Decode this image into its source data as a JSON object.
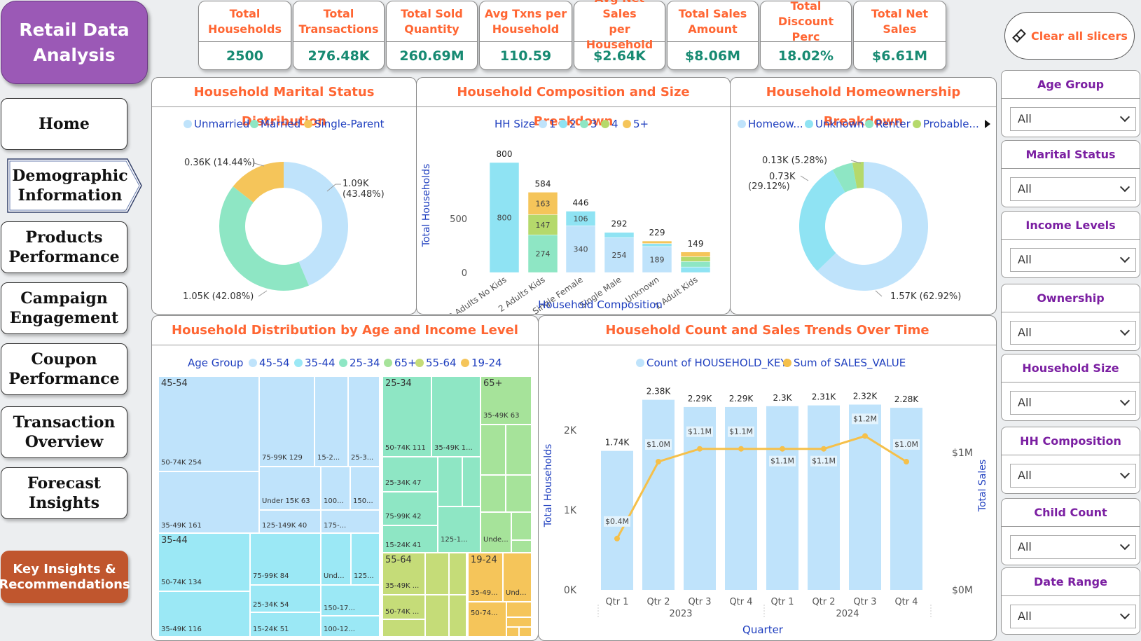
{
  "title": {
    "line1": "Retail Data",
    "line2": "Analysis"
  },
  "nav": {
    "home": "Home",
    "demographic": [
      "Demographic",
      "Information"
    ],
    "products": [
      "Products",
      "Performance"
    ],
    "campaign": [
      "Campaign",
      "Engagement"
    ],
    "coupon": [
      "Coupon",
      "Performance"
    ],
    "transaction": [
      "Transaction",
      "Overview"
    ],
    "forecast": [
      "Forecast",
      "Insights"
    ],
    "key": [
      "Key Insights &",
      "Recommendations"
    ]
  },
  "kpis": [
    {
      "label1": "Total",
      "label2": "Households",
      "value": "2500"
    },
    {
      "label1": "Total",
      "label2": "Transactions",
      "value": "276.48K"
    },
    {
      "label1": "Total Sold",
      "label2": "Quantity",
      "value": "260.69M"
    },
    {
      "label1": "Avg Txns per",
      "label2": "Household",
      "value": "110.59"
    },
    {
      "label1": "Avg Net Sales",
      "label2": "per Household",
      "value": "$2.64K"
    },
    {
      "label1": "Total Sales",
      "label2": "Amount",
      "value": "$8.06M"
    },
    {
      "label1": "Total Discount",
      "label2": "Perc",
      "value": "18.02%"
    },
    {
      "label1": "Total Net",
      "label2": "Sales",
      "value": "$6.61M"
    }
  ],
  "clear_slicers": "Clear all slicers",
  "slicers": [
    {
      "title": "Age Group",
      "value": "All"
    },
    {
      "title": "Marital Status",
      "value": "All"
    },
    {
      "title": "Income Levels",
      "value": "All"
    },
    {
      "title": "Ownership",
      "value": "All"
    },
    {
      "title": "Household Size",
      "value": "All"
    },
    {
      "title": "HH Composition",
      "value": "All"
    },
    {
      "title": "Child Count",
      "value": "All"
    },
    {
      "title": "Date Range",
      "value": "All"
    }
  ],
  "colors": {
    "accent": "#ff6633",
    "purple": "#9b59b6",
    "teal": "#178a72",
    "slicer_title": "#7b1fa2",
    "axis_blue": "#1f3fbf"
  },
  "chart_data": [
    {
      "type": "pie",
      "title": "Household Marital Status Distribution",
      "categories": [
        "Unmarried",
        "Married",
        "Single-Parent"
      ],
      "values": [
        1.09,
        1.05,
        0.36
      ],
      "percents": [
        43.48,
        42.08,
        14.44
      ],
      "labels": [
        "1.09K (43.48%)",
        "1.05K (42.08%)",
        "0.36K (14.44%)"
      ],
      "colors": [
        "#bfe3fb",
        "#8ee6c4",
        "#f5c55a"
      ],
      "legend": "top"
    },
    {
      "type": "bar",
      "title": "Household Composition and Size Breakdown",
      "legend_title": "HH Size",
      "xlabel": "Household Composition",
      "ylabel": "Total Households",
      "ylim": [
        0,
        800
      ],
      "yticks": [
        "0",
        "500"
      ],
      "categories": [
        "2 Adults No Kids",
        "2 Adults Kids",
        "Single Female",
        "Single Male",
        "Unknown",
        "1 Adult Kids"
      ],
      "totals": [
        800,
        584,
        446,
        292,
        229,
        149
      ],
      "series": [
        {
          "name": "1",
          "color": "#bfe3fb",
          "values": [
            0,
            0,
            340,
            254,
            189,
            0
          ]
        },
        {
          "name": "2",
          "color": "#8fe3f3",
          "values": [
            800,
            0,
            106,
            38,
            22,
            40
          ]
        },
        {
          "name": "3",
          "color": "#8ee6c4",
          "values": [
            0,
            274,
            0,
            0,
            0,
            40
          ]
        },
        {
          "name": "4",
          "color": "#b5d96b",
          "values": [
            0,
            147,
            0,
            0,
            0,
            35
          ]
        },
        {
          "name": "5+",
          "color": "#f5c55a",
          "values": [
            0,
            163,
            0,
            0,
            18,
            34
          ]
        }
      ],
      "data_labels": [
        "800",
        "163",
        "147",
        "274",
        "106",
        "340",
        "254",
        "189"
      ]
    },
    {
      "type": "pie",
      "title": "Household Homeownership Breakdown",
      "categories": [
        "Homeow...",
        "Unknown",
        "Renter",
        "Probable..."
      ],
      "values": [
        1.57,
        0.73,
        0.13,
        0.07
      ],
      "percents": [
        62.92,
        29.12,
        5.28,
        2.68
      ],
      "labels": [
        "1.57K (62.92%)",
        "0.73K (29.12%)",
        "0.13K (5.28%)"
      ],
      "colors": [
        "#bfe3fb",
        "#8fe3f3",
        "#8ee6c4",
        "#b5d96b",
        "#f5c55a"
      ],
      "legend": "top"
    },
    {
      "type": "heatmap",
      "title": "Household Distribution by Age and Income Level",
      "legend_title": "Age Group",
      "legend": [
        "45-54",
        "35-44",
        "25-34",
        "65+",
        "55-64",
        "19-24"
      ],
      "legend_colors": [
        "#bfe3fb",
        "#9be8f5",
        "#8ee6c4",
        "#a6e39a",
        "#c5dc78",
        "#f5c55a"
      ],
      "groups": [
        {
          "name": "45-54",
          "tiles": [
            "50-74K 254",
            "35-49K 161",
            "75-99K 129",
            "Under 15K 63",
            "125-149K 40",
            "15-2...",
            "25-3...",
            "100...",
            "150...",
            "175-..."
          ]
        },
        {
          "name": "35-44",
          "tiles": [
            "50-74K 134",
            "35-49K 116",
            "75-99K 84",
            "25-34K 54",
            "15-24K 51",
            "Und...",
            "125...",
            "150-17...",
            "100-12..."
          ]
        },
        {
          "name": "25-34",
          "tiles": [
            "50-74K 111",
            "35-49K 1...",
            "25-34K 47",
            "75-99K 42",
            "15-24K 41",
            "125-1..."
          ]
        },
        {
          "name": "65+",
          "tiles": [
            "35-49K 63",
            "Unde..."
          ]
        },
        {
          "name": "55-64",
          "tiles": [
            "35-49K ...",
            "50-74K ..."
          ]
        },
        {
          "name": "19-24",
          "tiles": [
            "35-49...",
            "Und...",
            "50-74..."
          ]
        }
      ]
    },
    {
      "type": "bar",
      "title": "Household Count and Sales Trends Over Time",
      "xlabel": "Quarter",
      "ylabel": "Total Households",
      "y2label": "Total Sales",
      "yticks": [
        "0K",
        "1K",
        "2K"
      ],
      "y2ticks": [
        "$0M",
        "$1M"
      ],
      "categories": [
        "Qtr 1",
        "Qtr 2",
        "Qtr 3",
        "Qtr 4",
        "Qtr 1",
        "Qtr 2",
        "Qtr 3",
        "Qtr 4"
      ],
      "years": [
        "2023",
        "2024"
      ],
      "series": [
        {
          "name": "Count of HOUSEHOLD_KEY",
          "color": "#bfe3fb",
          "values": [
            1.74,
            2.38,
            2.29,
            2.29,
            2.3,
            2.31,
            2.32,
            2.28
          ],
          "labels": [
            "1.74K",
            "2.38K",
            "2.29K",
            "2.29K",
            "2.3K",
            "2.31K",
            "2.32K",
            "2.28K"
          ]
        },
        {
          "name": "Sum of SALES_VALUE",
          "color": "#f5c04a",
          "type": "line",
          "values": [
            0.4,
            1.0,
            1.1,
            1.1,
            1.1,
            1.1,
            1.2,
            1.0
          ],
          "labels": [
            "$0.4M",
            "$1.0M",
            "$1.1M",
            "$1.1M",
            "$1.1M",
            "$1.1M",
            "$1.2M",
            "$1.0M"
          ]
        }
      ]
    }
  ]
}
